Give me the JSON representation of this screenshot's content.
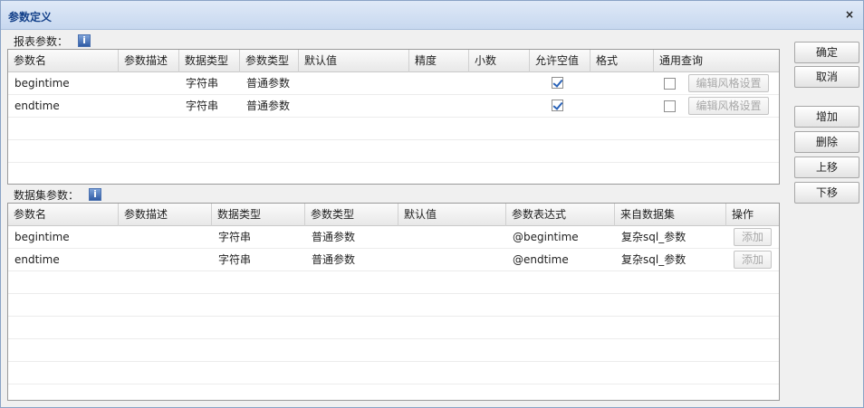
{
  "dialog": {
    "title": "参数定义",
    "close_label": "×"
  },
  "report_params": {
    "label": "报表参数：",
    "info_icon": "i",
    "columns": [
      "参数名",
      "参数描述",
      "数据类型",
      "参数类型",
      "默认值",
      "精度",
      "小数",
      "允许空值",
      "格式",
      "通用查询"
    ],
    "rows": [
      {
        "name": "begintime",
        "desc": "",
        "data_type": "字符串",
        "param_type": "普通参数",
        "default": "",
        "precision": "",
        "decimal": "",
        "nullable": true,
        "format": "",
        "general_query": false,
        "style_button": "编辑风格设置"
      },
      {
        "name": "endtime",
        "desc": "",
        "data_type": "字符串",
        "param_type": "普通参数",
        "default": "",
        "precision": "",
        "decimal": "",
        "nullable": true,
        "format": "",
        "general_query": false,
        "style_button": "编辑风格设置"
      }
    ]
  },
  "dataset_params": {
    "label": "数据集参数：",
    "info_icon": "i",
    "columns": [
      "参数名",
      "参数描述",
      "数据类型",
      "参数类型",
      "默认值",
      "参数表达式",
      "来自数据集",
      "操作"
    ],
    "rows": [
      {
        "name": "begintime",
        "desc": "",
        "data_type": "字符串",
        "param_type": "普通参数",
        "default": "",
        "expression": "@begintime",
        "dataset": "复杂sql_参数",
        "action": "添加"
      },
      {
        "name": "endtime",
        "desc": "",
        "data_type": "字符串",
        "param_type": "普通参数",
        "default": "",
        "expression": "@endtime",
        "dataset": "复杂sql_参数",
        "action": "添加"
      }
    ]
  },
  "side_buttons": {
    "ok": "确定",
    "cancel": "取消",
    "add": "增加",
    "delete": "删除",
    "up": "上移",
    "down": "下移"
  }
}
